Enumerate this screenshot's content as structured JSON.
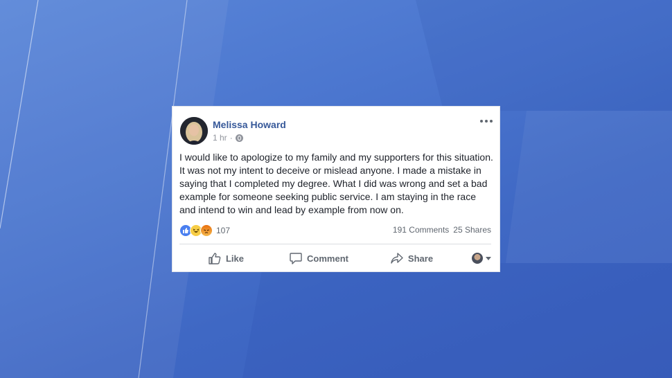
{
  "post": {
    "author": "Melissa Howard",
    "time": "1 hr",
    "separator": "·",
    "privacy_icon": "globe-icon",
    "more_icon": "more-options-icon",
    "text": "I would like to apologize to my family and my supporters for this situation. It was not my intent to deceive or mislead anyone. I made a mistake in saying that I completed my degree. What I did was wrong and set a bad example for someone seeking public service. I am staying in the race and intend to win and lead by example from now on.",
    "reactions": {
      "icons": [
        "like-reaction-icon",
        "haha-reaction-icon",
        "angry-reaction-icon"
      ],
      "count": "107"
    },
    "comments": "191 Comments",
    "shares": "25 Shares",
    "actions": {
      "like": "Like",
      "comment": "Comment",
      "share": "Share"
    }
  },
  "colors": {
    "author_link": "#365899",
    "secondary_text": "#606770",
    "background": "#4b76cf"
  }
}
